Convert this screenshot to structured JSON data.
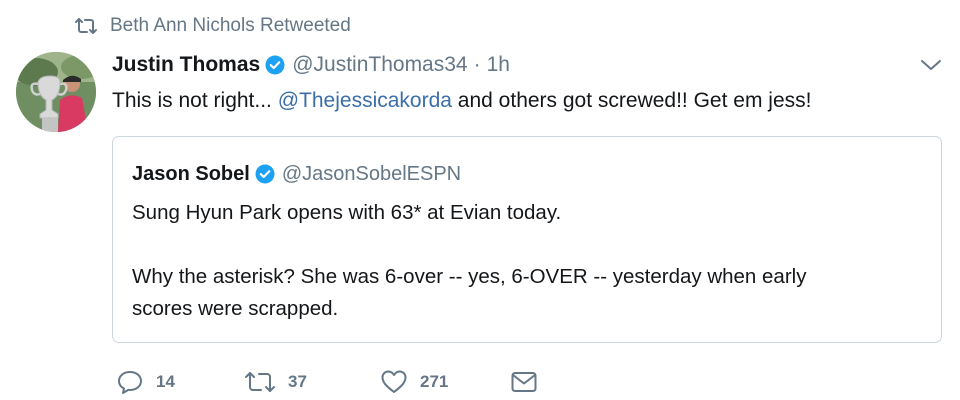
{
  "retweet_context": {
    "icon": "retweet-icon",
    "text": "Beth Ann Nichols Retweeted"
  },
  "tweet": {
    "author": {
      "name": "Justin Thomas",
      "handle": "@JustinThomas34",
      "verified": true,
      "avatar": "avatar-photo"
    },
    "separator": "·",
    "time": "1h",
    "text_before": "This is not right... ",
    "mention": "@Thejessicakorda",
    "text_after": " and others got screwed!! Get em jess!",
    "menu_icon": "chevron-down-icon"
  },
  "quoted_tweet": {
    "author": {
      "name": "Jason Sobel",
      "handle": "@JasonSobelESPN",
      "verified": true
    },
    "line1": "Sung Hyun Park opens with 63* at Evian today.",
    "line2": "Why the asterisk? She was 6-over -- yes, 6-OVER -- yesterday when early",
    "line3": "scores were scrapped."
  },
  "actions": {
    "reply": {
      "icon": "reply-icon",
      "count": "14"
    },
    "retweet": {
      "icon": "retweet-icon",
      "count": "37"
    },
    "like": {
      "icon": "heart-icon",
      "count": "271"
    },
    "message": {
      "icon": "message-icon"
    }
  },
  "colors": {
    "link": "#3b6ea8",
    "muted": "#657786",
    "verified": "#1da1f2",
    "border": "#ccd6dd",
    "text": "#14171a"
  }
}
